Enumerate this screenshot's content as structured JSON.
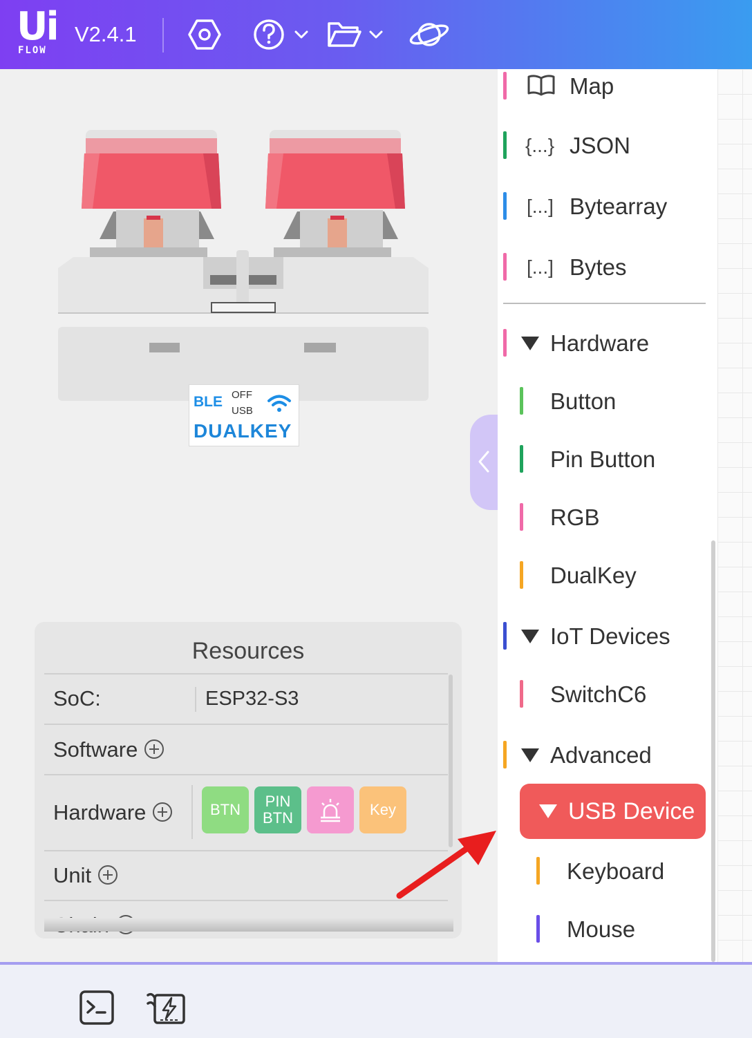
{
  "header": {
    "logo_top": "Ui",
    "logo_bottom": "FLOW",
    "version": "V2.4.1",
    "gradient": [
      "#7e3ff2",
      "#3a9cf0"
    ],
    "icons": [
      "settings-icon",
      "help-icon",
      "folder-icon",
      "planet-icon"
    ]
  },
  "device": {
    "ble_label": "BLE",
    "switch_off": "OFF",
    "switch_usb": "USB",
    "name": "DUALKEY",
    "keycap_color": "#f05868"
  },
  "resources": {
    "title": "Resources",
    "soc_label": "SoC:",
    "soc_value": "ESP32-S3",
    "software_label": "Software",
    "hardware_label": "Hardware",
    "unit_label": "Unit",
    "chain_label": "Chain",
    "hardware_chips": [
      {
        "label": "BTN",
        "color": "#8fdc82"
      },
      {
        "label": "PIN\nBTN",
        "color": "#5cbf8a"
      },
      {
        "label": "",
        "icon": "rgb-light-icon",
        "color": "#f59ad0"
      },
      {
        "label": "Key",
        "color": "#fbc27a"
      }
    ]
  },
  "sidebar": {
    "items": [
      {
        "label": "Map",
        "icon": "book-icon",
        "color": "#f06aa8"
      },
      {
        "label": "JSON",
        "icon_text": "{...}",
        "color": "#1fa35c"
      },
      {
        "label": "Bytearray",
        "icon_text": "[...]",
        "color": "#2d8de8"
      },
      {
        "label": "Bytes",
        "icon_text": "[...]",
        "color": "#f06aa8"
      },
      {
        "label": "Hardware",
        "color": "#f06aa8"
      },
      {
        "label": "Button",
        "color": "#5bc35b"
      },
      {
        "label": "Pin Button",
        "color": "#1fa35c"
      },
      {
        "label": "RGB",
        "color": "#f06aa8"
      },
      {
        "label": "DualKey",
        "color": "#f5a623"
      },
      {
        "label": "IoT Devices",
        "color": "#3b4fd1"
      },
      {
        "label": "SwitchC6",
        "color": "#f06a8a"
      },
      {
        "label": "Advanced",
        "color": "#f5a623"
      },
      {
        "label": "USB Device",
        "color": "#f05a5a"
      },
      {
        "label": "Keyboard",
        "color": "#f5a623"
      },
      {
        "label": "Mouse",
        "color": "#6a4ee8"
      }
    ]
  },
  "bottom": {
    "icons": [
      "terminal-icon",
      "flash-icon"
    ]
  }
}
